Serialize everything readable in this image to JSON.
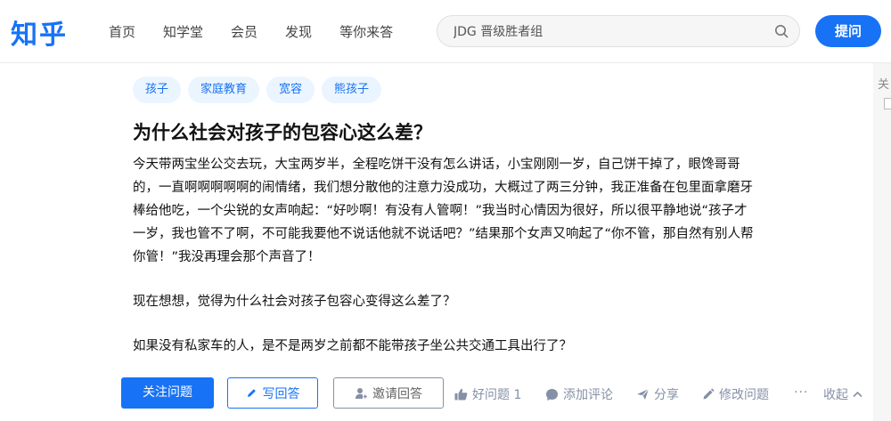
{
  "header": {
    "logo": "知乎",
    "nav": [
      "首页",
      "知学堂",
      "会员",
      "发现",
      "等你来答"
    ],
    "search_placeholder": "JDG 晋级胜者组",
    "ask_label": "提问"
  },
  "sidebar_peek": {
    "text": "关"
  },
  "question": {
    "tags": [
      "孩子",
      "家庭教育",
      "宽容",
      "熊孩子"
    ],
    "title": "为什么社会对孩子的包容心这么差？",
    "paragraphs": [
      "今天带两宝坐公交去玩，大宝两岁半，全程吃饼干没有怎么讲话，小宝刚刚一岁，自己饼干掉了，眼馋哥哥的，一直啊啊啊啊啊的闹情绪，我们想分散他的注意力没成功，大概过了两三分钟，我正准备在包里面拿磨牙棒给他吃，一个尖锐的女声响起：“好吵啊！有没有人管啊！”我当时心情因为很好，所以很平静地说“孩子才一岁，我也管不了啊，不可能我要他不说话他就不说话吧？”结果那个女声又响起了“你不管，那自然有别人帮你管！”我没再理会那个声音了！",
      "现在想想，觉得为什么社会对孩子包容心变得这么差了？",
      "如果没有私家车的人，是不是两岁之前都不能带孩子坐公共交通工具出行了？"
    ]
  },
  "actions": {
    "follow": "关注问题",
    "write_answer": "写回答",
    "invite": "邀请回答",
    "upvote": "好问题 1",
    "comment": "添加评论",
    "share": "分享",
    "edit": "修改问题",
    "more": "···",
    "collapse": "收起"
  },
  "colors": {
    "brand": "#1772f6",
    "tag_bg": "#ebf5ff",
    "muted": "#8590a6"
  }
}
